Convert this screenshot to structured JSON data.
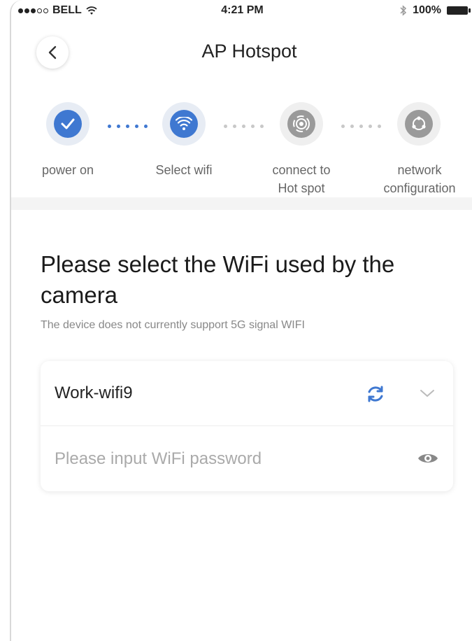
{
  "status_bar": {
    "carrier": "BELL",
    "time": "4:21 PM",
    "battery": "100%"
  },
  "header": {
    "title": "AP Hotspot"
  },
  "steps": [
    {
      "label_line1": "power on",
      "label_line2": "",
      "state": "done"
    },
    {
      "label_line1": "Select wifi",
      "label_line2": "",
      "state": "active"
    },
    {
      "label_line1": "connect to",
      "label_line2": "Hot spot",
      "state": "pending"
    },
    {
      "label_line1": "network",
      "label_line2": "configuration",
      "state": "pending"
    }
  ],
  "main": {
    "heading": "Please select the WiFi used by the camera",
    "note": "The device does not currently support 5G signal WIFI"
  },
  "form": {
    "wifi_name": "Work-wifi9",
    "password_value": "",
    "password_placeholder": "Please input WiFi password"
  },
  "colors": {
    "accent": "#3f78d1",
    "inactive": "#9a9a9a"
  }
}
